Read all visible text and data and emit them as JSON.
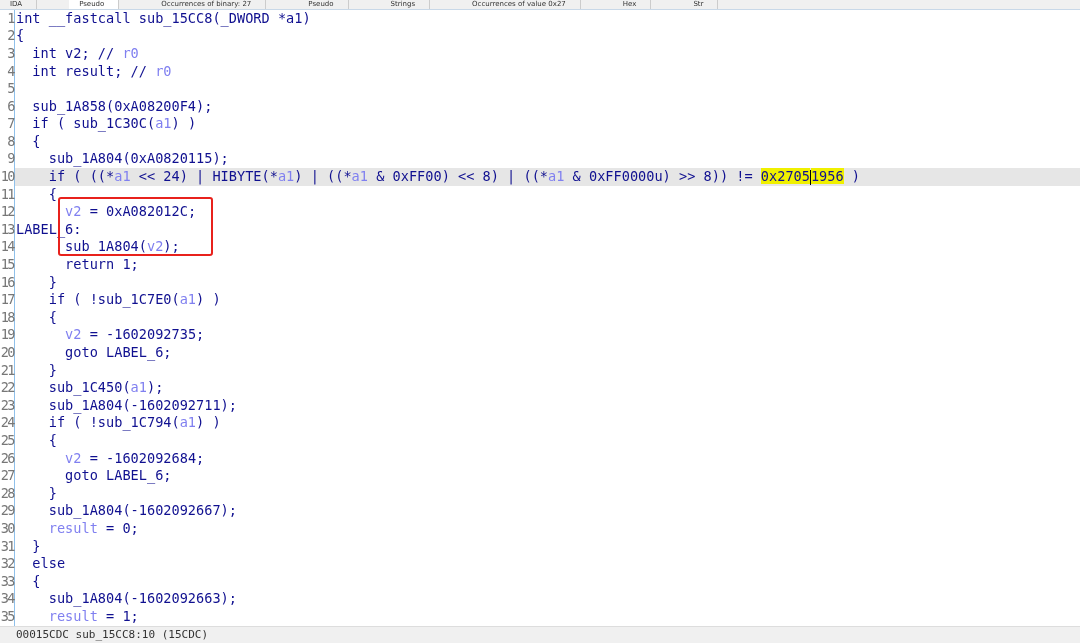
{
  "tabs": [
    {
      "label": "IDA",
      "selected": false
    },
    {
      "label": "Pseudo",
      "selected": true
    },
    {
      "label": "Occurrences of binary: 27",
      "selected": false
    },
    {
      "label": "Pseudo",
      "selected": false
    },
    {
      "label": "Strings",
      "selected": false
    },
    {
      "label": "Occurrences of value 0x27",
      "selected": false
    },
    {
      "label": "Hex",
      "selected": false
    },
    {
      "label": "Str",
      "selected": false
    }
  ],
  "code_lines": [
    {
      "number": "1",
      "current": false,
      "boxed": false,
      "tokens": [
        {
          "text": "int __fastcall sub_15CC8(_DWORD *a1)",
          "kind": "code"
        }
      ]
    },
    {
      "number": "2",
      "current": false,
      "boxed": false,
      "tokens": [
        {
          "text": "{",
          "kind": "code"
        }
      ]
    },
    {
      "number": "3",
      "current": false,
      "boxed": false,
      "tokens": [
        {
          "text": "  int v2; // ",
          "kind": "code"
        },
        {
          "text": "r0",
          "kind": "var"
        }
      ]
    },
    {
      "number": "4",
      "current": false,
      "boxed": false,
      "tokens": [
        {
          "text": "  int result; // ",
          "kind": "code"
        },
        {
          "text": "r0",
          "kind": "var"
        }
      ]
    },
    {
      "number": "5",
      "current": false,
      "boxed": false
    },
    {
      "number": "6",
      "current": false,
      "boxed": false,
      "tokens": [
        {
          "text": "  sub_1A858(0xA08200F4);",
          "kind": "code"
        }
      ]
    },
    {
      "number": "7",
      "current": false,
      "boxed": false,
      "tokens": [
        {
          "text": "  if ( sub_1C30C(",
          "kind": "code"
        },
        {
          "text": "a1",
          "kind": "var"
        },
        {
          "text": ") )",
          "kind": "code"
        }
      ]
    },
    {
      "number": "8",
      "current": false,
      "boxed": false,
      "tokens": [
        {
          "text": "  {",
          "kind": "code"
        }
      ]
    },
    {
      "number": "9",
      "current": false,
      "boxed": false,
      "tokens": [
        {
          "text": "    sub_1A804(0xA0820115);",
          "kind": "code"
        }
      ]
    },
    {
      "number": "10",
      "current": true,
      "boxed": false,
      "tokens": [
        {
          "text": "    if ( ((*",
          "kind": "code"
        },
        {
          "text": "a1",
          "kind": "var"
        },
        {
          "text": " << 24) | HIBYTE(*",
          "kind": "code"
        },
        {
          "text": "a1",
          "kind": "var"
        },
        {
          "text": ") | ((*",
          "kind": "code"
        },
        {
          "text": "a1",
          "kind": "var"
        },
        {
          "text": " & 0xFF00) << 8) | ((*",
          "kind": "code"
        },
        {
          "text": "a1",
          "kind": "var"
        },
        {
          "text": " & 0xFF0000u) >> 8)) != ",
          "kind": "code"
        },
        {
          "text": "0x2705",
          "kind": "match",
          "cursor": true
        },
        {
          "text": "1956",
          "kind": "match",
          "cursor": false
        },
        {
          "text": " )",
          "kind": "code"
        }
      ]
    },
    {
      "number": "11",
      "current": false,
      "boxed": false,
      "tokens": [
        {
          "text": "    {",
          "kind": "code"
        }
      ]
    },
    {
      "number": "12",
      "current": false,
      "boxed": true,
      "tokens": [
        {
          "text": "      v2",
          "kind": "var"
        },
        {
          "text": " = 0xA082012C;",
          "kind": "code"
        }
      ]
    },
    {
      "number": "13",
      "current": false,
      "boxed": true,
      "tokens": [
        {
          "text": "LABEL_6:",
          "kind": "code"
        }
      ]
    },
    {
      "number": "14",
      "current": false,
      "boxed": true,
      "tokens": [
        {
          "text": "      sub_1A804(",
          "kind": "code"
        },
        {
          "text": "v2",
          "kind": "var"
        },
        {
          "text": ");",
          "kind": "code"
        }
      ]
    },
    {
      "number": "15",
      "current": false,
      "boxed": false,
      "tokens": [
        {
          "text": "      return 1;",
          "kind": "code"
        }
      ]
    },
    {
      "number": "16",
      "current": false,
      "boxed": false,
      "tokens": [
        {
          "text": "    }",
          "kind": "code"
        }
      ]
    },
    {
      "number": "17",
      "current": false,
      "boxed": false,
      "tokens": [
        {
          "text": "    if ( !sub_1C7E0(",
          "kind": "code"
        },
        {
          "text": "a1",
          "kind": "var"
        },
        {
          "text": ") )",
          "kind": "code"
        }
      ]
    },
    {
      "number": "18",
      "current": false,
      "boxed": false,
      "tokens": [
        {
          "text": "    {",
          "kind": "code"
        }
      ]
    },
    {
      "number": "19",
      "current": false,
      "boxed": false,
      "tokens": [
        {
          "text": "      v2",
          "kind": "var"
        },
        {
          "text": " = -1602092735;",
          "kind": "code"
        }
      ]
    },
    {
      "number": "20",
      "current": false,
      "boxed": false,
      "tokens": [
        {
          "text": "      goto LABEL_6;",
          "kind": "code"
        }
      ]
    },
    {
      "number": "21",
      "current": false,
      "boxed": false,
      "tokens": [
        {
          "text": "    }",
          "kind": "code"
        }
      ]
    },
    {
      "number": "22",
      "current": false,
      "boxed": false,
      "tokens": [
        {
          "text": "    sub_1C450(",
          "kind": "code"
        },
        {
          "text": "a1",
          "kind": "var"
        },
        {
          "text": ");",
          "kind": "code"
        }
      ]
    },
    {
      "number": "23",
      "current": false,
      "boxed": false,
      "tokens": [
        {
          "text": "    sub_1A804(-1602092711);",
          "kind": "code"
        }
      ]
    },
    {
      "number": "24",
      "current": false,
      "boxed": false,
      "tokens": [
        {
          "text": "    if ( !sub_1C794(",
          "kind": "code"
        },
        {
          "text": "a1",
          "kind": "var"
        },
        {
          "text": ") )",
          "kind": "code"
        }
      ]
    },
    {
      "number": "25",
      "current": false,
      "boxed": false,
      "tokens": [
        {
          "text": "    {",
          "kind": "code"
        }
      ]
    },
    {
      "number": "26",
      "current": false,
      "boxed": false,
      "tokens": [
        {
          "text": "      v2",
          "kind": "var"
        },
        {
          "text": " = -1602092684;",
          "kind": "code"
        }
      ]
    },
    {
      "number": "27",
      "current": false,
      "boxed": false,
      "tokens": [
        {
          "text": "      goto LABEL_6;",
          "kind": "code"
        }
      ]
    },
    {
      "number": "28",
      "current": false,
      "boxed": false,
      "tokens": [
        {
          "text": "    }",
          "kind": "code"
        }
      ]
    },
    {
      "number": "29",
      "current": false,
      "boxed": false,
      "tokens": [
        {
          "text": "    sub_1A804(-1602092667);",
          "kind": "code"
        }
      ]
    },
    {
      "number": "30",
      "current": false,
      "boxed": false,
      "tokens": [
        {
          "text": "    result",
          "kind": "var"
        },
        {
          "text": " = 0;",
          "kind": "code"
        }
      ]
    },
    {
      "number": "31",
      "current": false,
      "boxed": false,
      "tokens": [
        {
          "text": "  }",
          "kind": "code"
        }
      ]
    },
    {
      "number": "32",
      "current": false,
      "boxed": false,
      "tokens": [
        {
          "text": "  else",
          "kind": "code"
        }
      ]
    },
    {
      "number": "33",
      "current": false,
      "boxed": false,
      "tokens": [
        {
          "text": "  {",
          "kind": "code"
        }
      ]
    },
    {
      "number": "34",
      "current": false,
      "boxed": false,
      "tokens": [
        {
          "text": "    sub_1A804(-1602092663);",
          "kind": "code"
        }
      ]
    },
    {
      "number": "35",
      "current": false,
      "boxed": false,
      "tokens": [
        {
          "text": "    result",
          "kind": "var"
        },
        {
          "text": " = 1;",
          "kind": "code"
        }
      ]
    }
  ],
  "status_bar": "00015CDC sub_15CC8:10 (15CDC)"
}
